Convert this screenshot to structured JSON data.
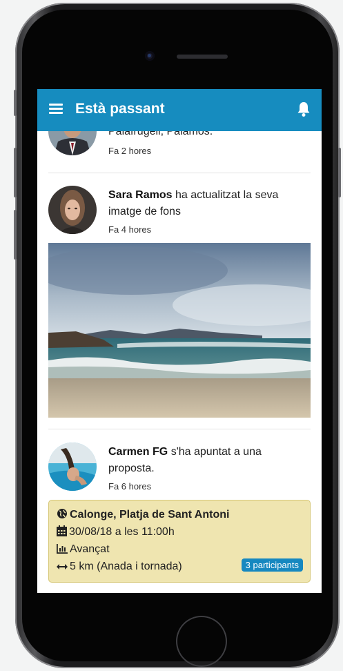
{
  "app": {
    "title": "Està passant"
  },
  "feed": {
    "posts": [
      {
        "partial_text": "Palafrugell, Palamós.",
        "time": "Fa 2 hores"
      },
      {
        "author": "Sara Ramos",
        "action": " ha actualitzat la seva imatge de fons",
        "time": "Fa 4 hores"
      },
      {
        "author": "Carmen FG",
        "action": " s'ha apuntat a una proposta.",
        "time": "Fa 6 hores"
      }
    ],
    "proposal": {
      "location": "Calonge, Platja de Sant Antoni",
      "datetime": "30/08/18 a les 11:00h",
      "level": "Avançat",
      "distance": "5 km (Anada i tornada)",
      "participants": "3 participants"
    }
  },
  "icons": [
    "menu-icon",
    "bell-icon",
    "globe-icon",
    "calendar-icon",
    "chart-icon",
    "arrows-horizontal-icon"
  ],
  "colors": {
    "appbar": "#168cbf",
    "card_bg": "#efe5b0",
    "badge": "#1688c0"
  }
}
